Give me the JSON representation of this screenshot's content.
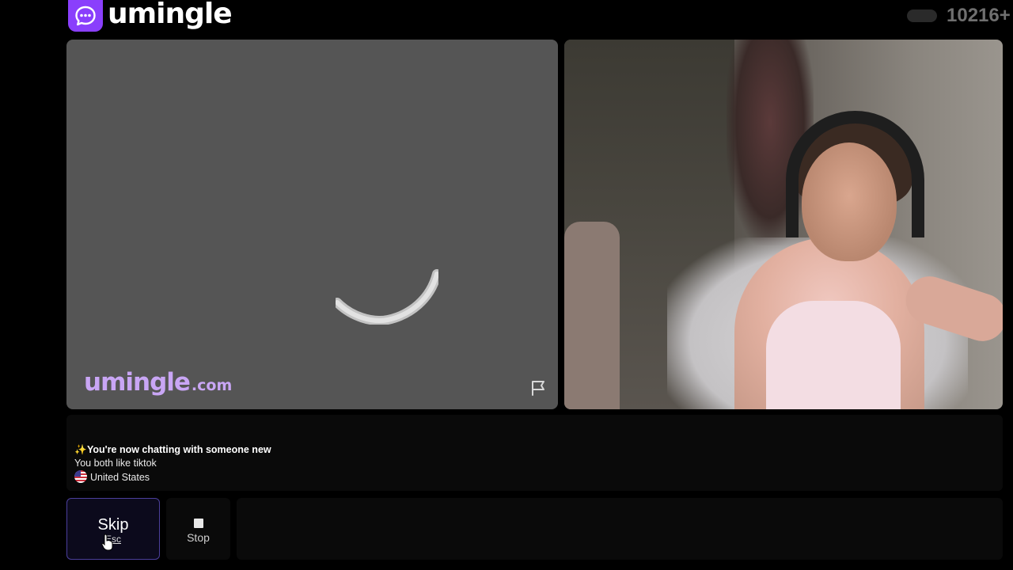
{
  "header": {
    "logo_text": "umingle",
    "logo_icon": "chat-bubble-icon",
    "online_count": "10216+"
  },
  "stranger_video": {
    "watermark_main": "umingle",
    "watermark_suffix": ".com",
    "loading_icon": "spinner-icon",
    "report_icon": "flag-icon"
  },
  "self_video": {
    "state": "camera-feed"
  },
  "chat": {
    "sparkle": "✨",
    "intro": "You're now chatting with someone new",
    "interest": "You both like tiktok",
    "country": "United States"
  },
  "controls": {
    "skip_label": "Skip",
    "skip_key": "Esc",
    "stop_label": "Stop",
    "message_placeholder": ""
  },
  "colors": {
    "brand": "#8a3ffc",
    "watermark": "#c9a6f5",
    "skip_border": "#4b3f9c"
  }
}
